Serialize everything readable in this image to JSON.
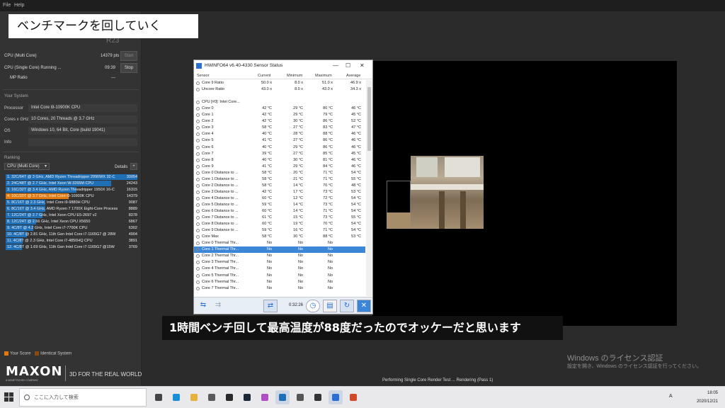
{
  "menubar": {
    "file": "File",
    "help": "Help"
  },
  "caption_top": "ベンチマークを回していく",
  "cinebench": {
    "logo_partial": "R23",
    "runs": [
      {
        "label": "CPU (Multi Core)",
        "score": "14379 pts",
        "button": "Start"
      },
      {
        "label": "CPU (Single Core)  Running ...",
        "score": "09:39",
        "button": "Stop"
      },
      {
        "label": "MP Ratio",
        "score": "---",
        "button": ""
      }
    ],
    "your_system_title": "Your System",
    "system": [
      {
        "label": "Processor",
        "value": "Intel Core i9-10900K CPU"
      },
      {
        "label": "Cores x GHz",
        "value": "10 Cores, 20 Threads @ 3.7 GHz"
      },
      {
        "label": "OS",
        "value": "Windows 10, 64 Bit, Core (build 19041)"
      },
      {
        "label": "Info",
        "value": ""
      }
    ],
    "ranking_title": "Ranking",
    "ranking_select": "CPU (Multi Core)",
    "details": "Details",
    "ranking": [
      {
        "text": "1. 32C/64T @ 3 GHz, AMD Ryzen Threadripper 2990WX 32-C",
        "score": "30054",
        "pct": 1.0,
        "color": "#1f6fb7"
      },
      {
        "text": "2. 24C/48T @ 2.7 GHz, Intel Xeon W-3265M CPU",
        "score": "24243",
        "pct": 0.8,
        "color": "#1f6fb7"
      },
      {
        "text": "3. 16C/32T @ 3.4 GHz, AMD Ryzen Threadripper 1950X 16-C",
        "score": "16315",
        "pct": 0.54,
        "color": "#1f6fb7"
      },
      {
        "text": "4. 10C/20T @ 3.7 GHz, Intel Core i9-10900K CPU",
        "score": "14379",
        "pct": 0.48,
        "color": "#e07a10"
      },
      {
        "text": "5. 8C/16T @ 2.3 GHz, Intel Core i9-9880H CPU",
        "score": "9087",
        "pct": 0.3,
        "color": "#1f6fb7"
      },
      {
        "text": "6. 8C/16T @ 3.4 GHz, AMD Ryzen 7 1700X Eight-Core Process",
        "score": "8889",
        "pct": 0.3,
        "color": "#1f6fb7"
      },
      {
        "text": "7. 12C/24T @ 2.7 GHz, Intel Xeon CPU E5-2697 v2",
        "score": "8378",
        "pct": 0.28,
        "color": "#1f6fb7"
      },
      {
        "text": "8. 12C/24T @ 2.66 GHz, Intel Xeon CPU X5650",
        "score": "6867",
        "pct": 0.23,
        "color": "#1f6fb7"
      },
      {
        "text": "9. 4C/8T @ 4.2 GHz, Intel Core i7-7700K CPU",
        "score": "6302",
        "pct": 0.21,
        "color": "#1f6fb7"
      },
      {
        "text": "10. 4C/8T @ 2.81 GHz, 11th Gen Intel Core i7-1165G7 @ 28W",
        "score": "4904",
        "pct": 0.16,
        "color": "#1f6fb7"
      },
      {
        "text": "11. 4C/8T @ 2.3 GHz, Intel Core i7-4850HQ CPU",
        "score": "3891",
        "pct": 0.13,
        "color": "#1f6fb7"
      },
      {
        "text": "12. 4C/8T @ 1.69 GHz, 11th Gen Intel Core i7-1165G7 @15W",
        "score": "3769",
        "pct": 0.125,
        "color": "#1f6fb7"
      }
    ],
    "legend_your": "Your Score",
    "legend_identical": "Identical System",
    "maxon": "MAXON",
    "maxon_sub": "A NEMETSCHEK COMPANY",
    "maxon_tag": "3D FOR THE REAL WORLD",
    "status": "Performing Single Core Render Test ... Rendering (Pass 1)"
  },
  "hwinfo": {
    "title": "HWiNFO64 v6.40-4330 Sensor Status",
    "headers": {
      "sensor": "Sensor",
      "current": "Current",
      "minimum": "Minimum",
      "maximum": "Maximum",
      "average": "Average"
    },
    "rows": [
      {
        "name": "Core 9 Ratio",
        "cur": "50.0 x",
        "min": "8.0 x",
        "max": "51.0 x",
        "avg": "46.9 x"
      },
      {
        "name": "Uncore Ratio",
        "cur": "43.0 x",
        "min": "8.0 x",
        "max": "43.0 x",
        "avg": "34.3 x"
      },
      {
        "name": "",
        "cur": "",
        "min": "",
        "max": "",
        "avg": ""
      },
      {
        "name": "CPU [#0]: Intel Core...",
        "cur": "",
        "min": "",
        "max": "",
        "avg": ""
      },
      {
        "name": "Core 0",
        "cur": "42 °C",
        "min": "29 °C",
        "max": "80 °C",
        "avg": "46 °C"
      },
      {
        "name": "Core 1",
        "cur": "42 °C",
        "min": "29 °C",
        "max": "79 °C",
        "avg": "45 °C"
      },
      {
        "name": "Core 2",
        "cur": "42 °C",
        "min": "30 °C",
        "max": "86 °C",
        "avg": "52 °C"
      },
      {
        "name": "Core 3",
        "cur": "58 °C",
        "min": "27 °C",
        "max": "83 °C",
        "avg": "47 °C"
      },
      {
        "name": "Core 4",
        "cur": "40 °C",
        "min": "28 °C",
        "max": "88 °C",
        "avg": "46 °C"
      },
      {
        "name": "Core 5",
        "cur": "41 °C",
        "min": "27 °C",
        "max": "86 °C",
        "avg": "46 °C"
      },
      {
        "name": "Core 6",
        "cur": "40 °C",
        "min": "29 °C",
        "max": "86 °C",
        "avg": "46 °C"
      },
      {
        "name": "Core 7",
        "cur": "39 °C",
        "min": "27 °C",
        "max": "85 °C",
        "avg": "45 °C"
      },
      {
        "name": "Core 8",
        "cur": "40 °C",
        "min": "30 °C",
        "max": "81 °C",
        "avg": "46 °C"
      },
      {
        "name": "Core 9",
        "cur": "41 °C",
        "min": "29 °C",
        "max": "84 °C",
        "avg": "46 °C"
      },
      {
        "name": "Core 0 Distance to ...",
        "cur": "58 °C",
        "min": "20 °C",
        "max": "71 °C",
        "avg": "54 °C"
      },
      {
        "name": "Core 1 Distance to ...",
        "cur": "58 °C",
        "min": "21 °C",
        "max": "71 °C",
        "avg": "55 °C"
      },
      {
        "name": "Core 2 Distance to ...",
        "cur": "58 °C",
        "min": "14 °C",
        "max": "70 °C",
        "avg": "48 °C"
      },
      {
        "name": "Core 3 Distance to ...",
        "cur": "42 °C",
        "min": "17 °C",
        "max": "73 °C",
        "avg": "53 °C"
      },
      {
        "name": "Core 4 Distance to ...",
        "cur": "60 °C",
        "min": "12 °C",
        "max": "72 °C",
        "avg": "54 °C"
      },
      {
        "name": "Core 5 Distance to ...",
        "cur": "59 °C",
        "min": "14 °C",
        "max": "73 °C",
        "avg": "54 °C"
      },
      {
        "name": "Core 6 Distance to ...",
        "cur": "60 °C",
        "min": "14 °C",
        "max": "71 °C",
        "avg": "54 °C"
      },
      {
        "name": "Core 7 Distance to ...",
        "cur": "61 °C",
        "min": "15 °C",
        "max": "73 °C",
        "avg": "55 °C"
      },
      {
        "name": "Core 8 Distance to ...",
        "cur": "60 °C",
        "min": "19 °C",
        "max": "70 °C",
        "avg": "54 °C"
      },
      {
        "name": "Core 9 Distance to ...",
        "cur": "59 °C",
        "min": "16 °C",
        "max": "71 °C",
        "avg": "54 °C"
      },
      {
        "name": "Core Max",
        "cur": "58 °C",
        "min": "30 °C",
        "max": "88 °C",
        "avg": "53 °C"
      },
      {
        "name": "Core 0 Thermal Thr...",
        "cur": "No",
        "min": "No",
        "max": "No",
        "avg": ""
      },
      {
        "name": "Core 1 Thermal Thr...",
        "cur": "No",
        "min": "No",
        "max": "No",
        "avg": ""
      },
      {
        "name": "Core 2 Thermal Thr...",
        "cur": "No",
        "min": "No",
        "max": "No",
        "avg": ""
      },
      {
        "name": "Core 3 Thermal Thr...",
        "cur": "No",
        "min": "No",
        "max": "No",
        "avg": ""
      },
      {
        "name": "Core 4 Thermal Thr...",
        "cur": "No",
        "min": "No",
        "max": "No",
        "avg": ""
      },
      {
        "name": "Core 5 Thermal Thr...",
        "cur": "No",
        "min": "No",
        "max": "No",
        "avg": ""
      },
      {
        "name": "Core 6 Thermal Thr...",
        "cur": "No",
        "min": "No",
        "max": "No",
        "avg": ""
      },
      {
        "name": "Core 7 Thermal Thr...",
        "cur": "No",
        "min": "No",
        "max": "No",
        "avg": ""
      }
    ],
    "selected_row": 26,
    "elapsed": "0:32:26"
  },
  "subtitle": "1時間ベンチ回して最高温度が88度だったのでオッケーだと思います",
  "watermark": {
    "line1": "Windows のライセンス認証",
    "line2": "設定を開き、Windows のライセンス認証を行ってください。"
  },
  "taskbar": {
    "search_placeholder": "ここに入力して検索",
    "ime": "A",
    "time": "18:05",
    "date": "2020/12/21",
    "apps": [
      {
        "name": "task-view-icon",
        "color": "#444"
      },
      {
        "name": "edge-icon",
        "color": "#1a8fd8"
      },
      {
        "name": "explorer-icon",
        "color": "#e8b23a"
      },
      {
        "name": "store-icon",
        "color": "#5a5a5a"
      },
      {
        "name": "xbox-icon",
        "color": "#2a2a2a"
      },
      {
        "name": "steam-icon",
        "color": "#1b2838"
      },
      {
        "name": "snip-icon",
        "color": "#b04ec8"
      },
      {
        "name": "cinebench-icon",
        "color": "#1f6fb7"
      },
      {
        "name": "calculator-icon",
        "color": "#555"
      },
      {
        "name": "settings-icon",
        "color": "#333"
      },
      {
        "name": "hwinfo-icon",
        "color": "#2a6fd6"
      },
      {
        "name": "app-icon",
        "color": "#d04a2a"
      }
    ]
  }
}
